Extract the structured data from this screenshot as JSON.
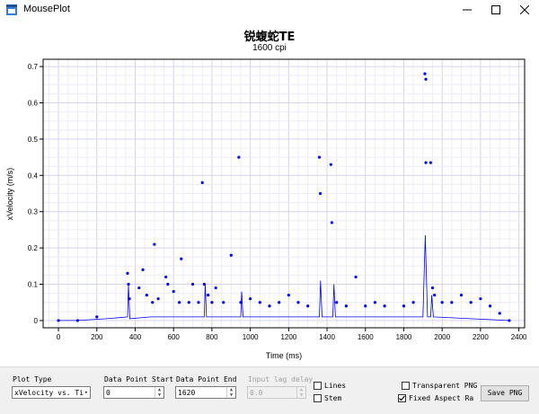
{
  "window": {
    "title": "MousePlot"
  },
  "chart_data": {
    "type": "scatter",
    "title": "锐蝮蛇TE",
    "subtitle": "1600 cpi",
    "xlabel": "Time (ms)",
    "ylabel": "xVelocity (m/s)",
    "xlim": [
      -80,
      2430
    ],
    "ylim": [
      -0.02,
      0.72
    ],
    "xticks": [
      0,
      200,
      400,
      600,
      800,
      1000,
      1200,
      1400,
      1600,
      1800,
      2000,
      2200,
      2400
    ],
    "yticks": [
      0,
      0.1,
      0.2,
      0.3,
      0.4,
      0.5,
      0.6,
      0.7
    ],
    "xtick_labels": [
      "0",
      "200",
      "400",
      "600",
      "800",
      "1000",
      "1200",
      "1400",
      "1600",
      "1800",
      "2000",
      "2200",
      "2400"
    ],
    "ytick_labels": [
      "0",
      "0.1",
      "0.2",
      "0.3",
      "0.4",
      "0.5",
      "0.6",
      "0.7"
    ],
    "grid": true,
    "series_color": "#0000ee",
    "points": [
      [
        0,
        0
      ],
      [
        100,
        0
      ],
      [
        200,
        0.01
      ],
      [
        360,
        0.13
      ],
      [
        365,
        0.1
      ],
      [
        370,
        0.06
      ],
      [
        420,
        0.09
      ],
      [
        440,
        0.14
      ],
      [
        460,
        0.07
      ],
      [
        490,
        0.05
      ],
      [
        500,
        0.21
      ],
      [
        520,
        0.06
      ],
      [
        560,
        0.12
      ],
      [
        570,
        0.1
      ],
      [
        600,
        0.08
      ],
      [
        630,
        0.05
      ],
      [
        640,
        0.17
      ],
      [
        680,
        0.05
      ],
      [
        700,
        0.1
      ],
      [
        730,
        0.05
      ],
      [
        750,
        0.38
      ],
      [
        760,
        0.1
      ],
      [
        780,
        0.07
      ],
      [
        800,
        0.05
      ],
      [
        820,
        0.09
      ],
      [
        860,
        0.05
      ],
      [
        900,
        0.18
      ],
      [
        940,
        0.45
      ],
      [
        950,
        0.05
      ],
      [
        1000,
        0.06
      ],
      [
        1050,
        0.05
      ],
      [
        1100,
        0.04
      ],
      [
        1150,
        0.05
      ],
      [
        1200,
        0.07
      ],
      [
        1250,
        0.05
      ],
      [
        1300,
        0.04
      ],
      [
        1360,
        0.45
      ],
      [
        1365,
        0.35
      ],
      [
        1420,
        0.43
      ],
      [
        1425,
        0.27
      ],
      [
        1450,
        0.05
      ],
      [
        1500,
        0.04
      ],
      [
        1550,
        0.12
      ],
      [
        1600,
        0.04
      ],
      [
        1650,
        0.05
      ],
      [
        1700,
        0.04
      ],
      [
        1800,
        0.04
      ],
      [
        1850,
        0.05
      ],
      [
        1910,
        0.68
      ],
      [
        1915,
        0.665
      ],
      [
        1915,
        0.435
      ],
      [
        1940,
        0.435
      ],
      [
        1950,
        0.09
      ],
      [
        1960,
        0.07
      ],
      [
        2000,
        0.05
      ],
      [
        2050,
        0.05
      ],
      [
        2100,
        0.07
      ],
      [
        2150,
        0.05
      ],
      [
        2200,
        0.06
      ],
      [
        2250,
        0.04
      ],
      [
        2300,
        0.02
      ],
      [
        2350,
        0
      ]
    ],
    "line": [
      [
        0,
        0
      ],
      [
        100,
        0
      ],
      [
        250,
        0.005
      ],
      [
        360,
        0.01
      ],
      [
        365,
        0.1
      ],
      [
        372,
        0.005
      ],
      [
        480,
        0.01
      ],
      [
        760,
        0.01
      ],
      [
        765,
        0.1
      ],
      [
        772,
        0.01
      ],
      [
        950,
        0.01
      ],
      [
        955,
        0.08
      ],
      [
        962,
        0.01
      ],
      [
        1360,
        0.01
      ],
      [
        1366,
        0.11
      ],
      [
        1374,
        0.01
      ],
      [
        1430,
        0.01
      ],
      [
        1436,
        0.1
      ],
      [
        1444,
        0.01
      ],
      [
        1900,
        0.01
      ],
      [
        1912,
        0.235
      ],
      [
        1924,
        0.01
      ],
      [
        1940,
        0.01
      ],
      [
        1946,
        0.07
      ],
      [
        1954,
        0.01
      ],
      [
        2350,
        0
      ]
    ]
  },
  "controls": {
    "plot_type": {
      "label": "Plot Type",
      "value": "xVelocity vs. Ti"
    },
    "start": {
      "label": "Data Point Start",
      "value": "0"
    },
    "end": {
      "label": "Data Point End",
      "value": "1620"
    },
    "lag": {
      "label": "Input lag delay",
      "value": "0.0"
    },
    "lines": {
      "label": "Lines",
      "checked": false
    },
    "stem": {
      "label": "Stem",
      "checked": false
    },
    "transparent": {
      "label": "Transparent PNG",
      "checked": false
    },
    "fixed": {
      "label": "Fixed Aspect Rat",
      "checked": true
    },
    "save": {
      "label": "Save PNG"
    }
  }
}
